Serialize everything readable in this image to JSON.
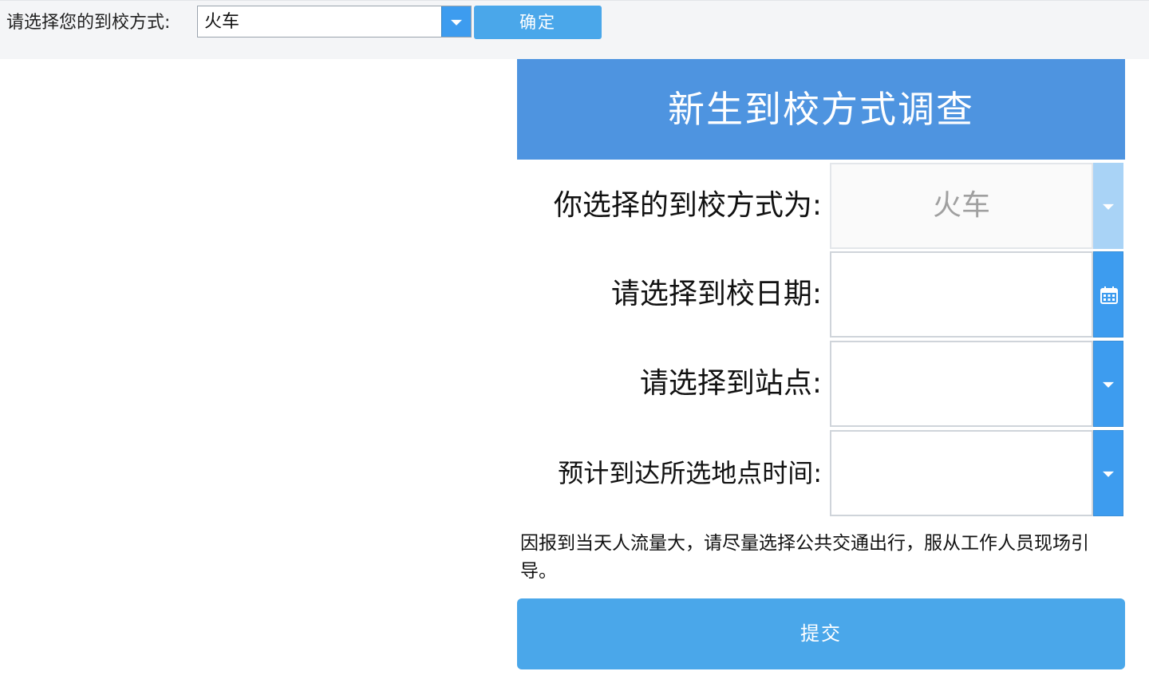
{
  "topbar": {
    "label": "请选择您的到校方式:",
    "select_value": "火车",
    "confirm_label": "确定"
  },
  "form": {
    "title": "新生到校方式调查",
    "rows": [
      {
        "label": "你选择的到校方式为:",
        "value": "火车"
      },
      {
        "label": "请选择到校日期:",
        "value": ""
      },
      {
        "label": "请选择到站点:",
        "value": ""
      },
      {
        "label": "预计到达所选地点时间:",
        "value": ""
      }
    ],
    "notice": "因报到当天人流量大，请尽量选择公共交通出行，服从工作人员现场引导。",
    "submit_label": "提交"
  },
  "icons": [
    "chevron-down-icon",
    "calendar-icon"
  ],
  "colors": {
    "header": "#4e94e0",
    "button": "#4aa7ea",
    "select_button": "#3d9cef",
    "disabled_button": "#a9d3f6"
  }
}
